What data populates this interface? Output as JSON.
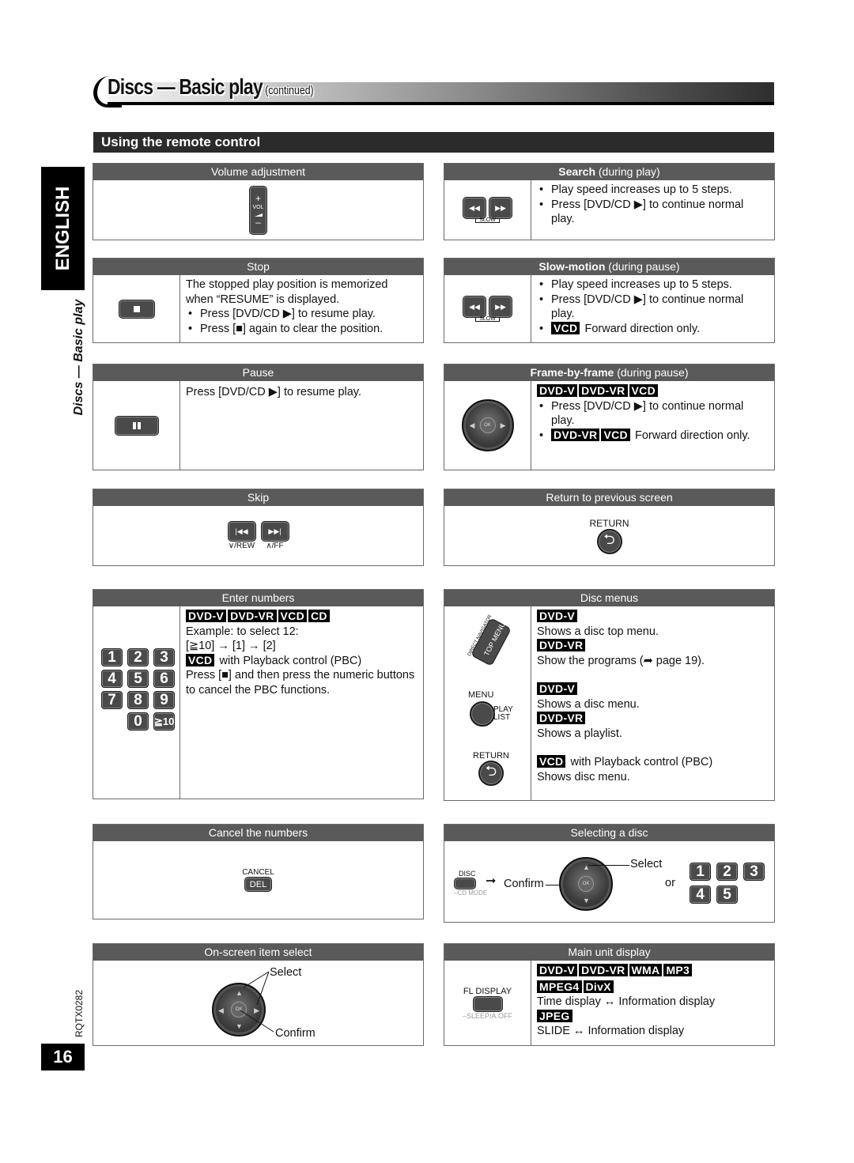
{
  "page": {
    "title": "Discs — Basic play",
    "title_suffix": "(continued)",
    "section_title": "Using the remote control",
    "language_tab": "ENGLISH",
    "side_label": "Discs — Basic play",
    "doc_code": "RQTX0282",
    "page_number": "16"
  },
  "boxes": {
    "volume": {
      "title": "Volume adjustment",
      "icon": "volume-rocker-icon",
      "icon_labels": {
        "plus": "+",
        "vol": "VOL",
        "minus": "–"
      }
    },
    "search": {
      "title_bold": "Search",
      "title_rest": " (during play)",
      "icon": "search-rew-ff-buttons-icon",
      "icon_label": "SLOW",
      "bullets": [
        "Play speed increases up to 5 steps.",
        "Press [DVD/CD ▶] to continue normal play."
      ]
    },
    "stop": {
      "title": "Stop",
      "icon": "stop-button-icon",
      "intro": "The stopped play position is memorized when “RESUME” is displayed.",
      "bullets": [
        "Press [DVD/CD ▶] to resume play.",
        "Press [■] again to clear the position."
      ]
    },
    "slow_motion": {
      "title_bold": "Slow-motion",
      "title_rest": " (during pause)",
      "icon": "slow-rew-ff-buttons-icon",
      "icon_label": "SLOW",
      "bullets": [
        "Play speed increases up to 5 steps.",
        "Press [DVD/CD ▶] to continue normal play."
      ],
      "tag_bullet": {
        "tags": [
          "VCD"
        ],
        "text": "Forward direction only."
      }
    },
    "pause": {
      "title": "Pause",
      "icon": "pause-button-icon",
      "text": "Press [DVD/CD ▶] to resume play."
    },
    "frame_by_frame": {
      "title_bold": "Frame-by-frame",
      "title_rest": " (during pause)",
      "icon": "dpad-left-right-icon",
      "ok_label": "OK",
      "tags": [
        "DVD-V",
        "DVD-VR",
        "VCD"
      ],
      "bullets": [
        "Press [DVD/CD ▶] to continue normal play."
      ],
      "tag_bullet": {
        "tags": [
          "DVD-VR",
          "VCD"
        ],
        "text": "Forward direction only."
      }
    },
    "skip": {
      "title": "Skip",
      "icon": "skip-prev-next-buttons-icon",
      "labels": [
        "∨/REW",
        "∧/FF"
      ]
    },
    "return_prev": {
      "title": "Return to previous screen",
      "icon": "return-button-icon",
      "label": "RETURN"
    },
    "enter_numbers": {
      "title": "Enter numbers",
      "icon": "numeric-keypad-icon",
      "keys": [
        "1",
        "2",
        "3",
        "4",
        "5",
        "6",
        "7",
        "8",
        "9",
        "0",
        "≧10"
      ],
      "tags": [
        "DVD-V",
        "DVD-VR",
        "VCD",
        "CD"
      ],
      "lines": [
        "Example: to select 12:",
        "[≧10] → [1] → [2]"
      ],
      "vcd_tag": "VCD",
      "vcd_text": "with Playback control (PBC)",
      "pbc_text": "Press [■] and then press the numeric buttons to cancel the PBC functions."
    },
    "disc_menus": {
      "title": "Disc menus",
      "icons": {
        "top_menu": {
          "name": "direct-navigator-top-menu-button-icon",
          "arc_label": "DIRECT NAVIGATOR",
          "label": "TOP MENU"
        },
        "menu": {
          "name": "menu-playlist-button-icon",
          "label_top": "MENU",
          "label_side": "PLAY LIST"
        },
        "return": {
          "name": "return-button-icon",
          "label": "RETURN"
        }
      },
      "entries": [
        {
          "tag": "DVD-V",
          "text": "Shows a disc top menu."
        },
        {
          "tag": "DVD-VR",
          "text": "Show the programs (➦ page 19)."
        },
        {
          "tag": "DVD-V",
          "text": "Shows a disc menu."
        },
        {
          "tag": "DVD-VR",
          "text": "Shows a playlist."
        }
      ],
      "vcd": {
        "tag": "VCD",
        "text": "with Playback control (PBC)",
        "text2": "Shows disc menu."
      }
    },
    "cancel_numbers": {
      "title": "Cancel the numbers",
      "icon": "cancel-del-button-icon",
      "label_top": "CANCEL",
      "label_btn": "DEL"
    },
    "selecting_disc": {
      "title": "Selecting a disc",
      "disc_label": "DISC",
      "cd_mode_label": "–CD MODE",
      "arrow": "➞",
      "confirm": "Confirm",
      "select": "Select",
      "or": "or",
      "ok_label": "OK",
      "keys": [
        "1",
        "2",
        "3",
        "4",
        "5"
      ]
    },
    "onscreen_select": {
      "title": "On-screen item select",
      "select": "Select",
      "confirm": "Confirm",
      "ok_label": "OK"
    },
    "main_unit_display": {
      "title": "Main unit display",
      "icon": "fl-display-button-icon",
      "label_top": "FL DISPLAY",
      "label_bottom": "–SLEEP/A.OFF",
      "tags_row1": [
        "DVD-V",
        "DVD-VR",
        "WMA",
        "MP3"
      ],
      "tags_row2": [
        "MPEG4",
        "DivX"
      ],
      "text1": "Time display ↔ Information display",
      "tag_jpeg": "JPEG",
      "text2": "SLIDE ↔ Information display"
    }
  }
}
